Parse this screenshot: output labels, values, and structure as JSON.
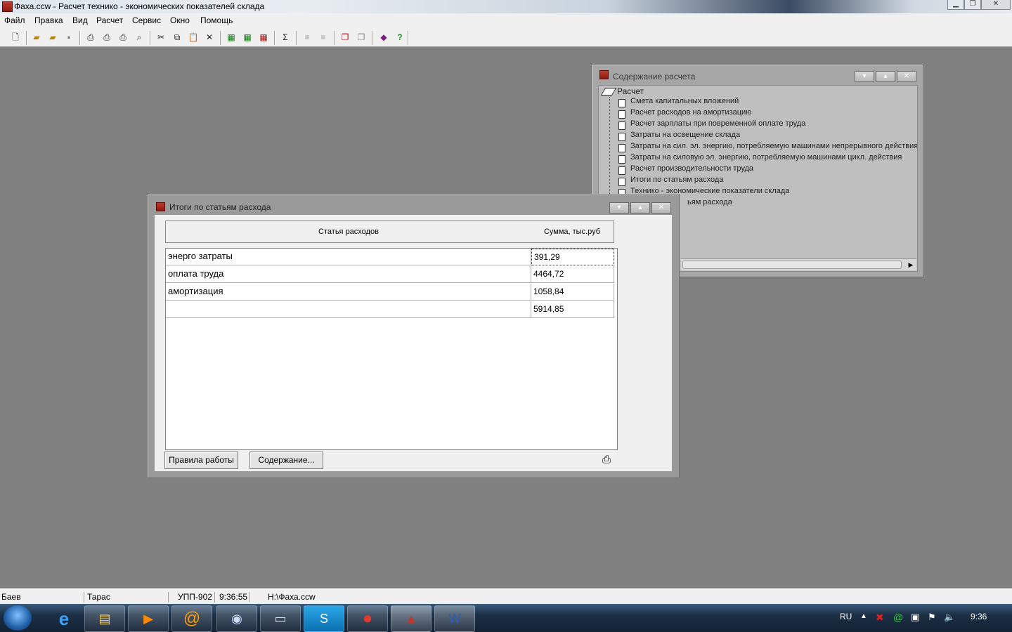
{
  "window": {
    "title": "Фаха.ccw - Расчет технико - экономических показателей склада"
  },
  "menu": [
    "Файл",
    "Правка",
    "Вид",
    "Расчет",
    "Сервис",
    "Окно",
    "Помощь"
  ],
  "toolbar": {
    "sum_symbol": "Σ",
    "help_symbol": "?"
  },
  "contents_window": {
    "title": "Содержание расчета",
    "root": "Расчет",
    "items": [
      "Смета капитальных вложений",
      "Расчет расходов на амортизацию",
      "Расчет зарплаты при повременной оплате труда",
      "Затраты на освещение склада",
      "Затраты на сил. эл. энергию, потребляемую машинами непрерывного действия",
      "Затраты на силовую эл. энергию, потребляемую машинами цикл. действия",
      "Расчет производительности труда",
      "Итоги по статьям расхода",
      "Технико - экономические показатели склада",
      "ьям расхода"
    ]
  },
  "totals_window": {
    "title": "Итоги по статьям расхода",
    "col_headers": [
      "Статья  расходов",
      "Сумма, тыс.руб"
    ],
    "rows": [
      [
        "энерго затраты",
        "391,29"
      ],
      [
        "оплата труда",
        "4464,72"
      ],
      [
        "амортизация",
        "1058,84"
      ],
      [
        "",
        "5914,85"
      ]
    ],
    "btn_rules": "Правила работы",
    "btn_contents": "Содержание..."
  },
  "status": {
    "user1": "Баев",
    "user2": "Тарас",
    "group": "УПП-902",
    "time": "9:36:55",
    "path": "H:\\Фаха.ccw"
  },
  "taskbar": {
    "lang": "RU",
    "clock": "9:36"
  }
}
